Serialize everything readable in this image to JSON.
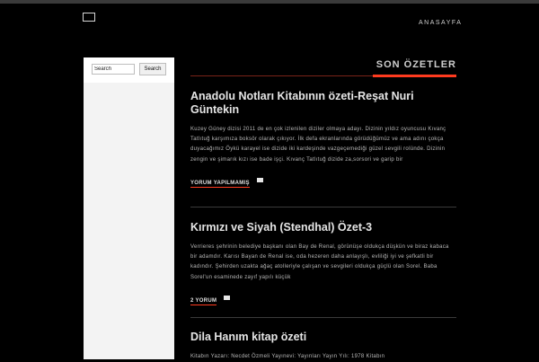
{
  "header": {
    "logo_icon": "square-outline-icon",
    "nav_home": "ANASAYFA"
  },
  "sidebar": {
    "search": {
      "placeholder": "Search",
      "button_label": "Search"
    }
  },
  "main": {
    "section_title": "SON ÖZETLER",
    "posts": [
      {
        "title": "Anadolu Notları Kitabının özeti-Reşat Nuri Güntekin",
        "excerpt": "Kuzey Güney dizisi 2011 de en çok izlenilen diziler olmaya adayı. Dizinin yıldız oyuncusu Kıvanç Tatlıtuğ karşımıza boksör olarak çıkıyor. İlk defa ekranlarında görüdüğümüz ve ama adını çokça duyacağımız Öykü karayel ise dizide iki kardeşinde vazgeçemediği güzel sevgili rolünde. Dizinin zengin ve şimarık kızı ise bade işçi. Kıvanç Tatlıtuğ dizide za,sorsori ve garip bir",
        "comments": "YORUM YAPILMAMIŞ"
      },
      {
        "title": "Kırmızı ve Siyah (Stendhal) Özet-3",
        "excerpt": "Verrieres şehrinin belediye başkanı olan Bay de Renal, görünüşe oldukça düşkün ve biraz kabaca bir adamdır. Karısı Bayan de Renal ise, oda hezeren daha anlayışlı, evliliği iyi ve şefkatli bir kadındır. Şehirden uzakta ağaç atolleriyle çalışan ve sevgileri oldukça güçlü olan Sorel. Baba Sorel'un esaminede zayıf yapılı küçük",
        "comments": "2 YORUM"
      },
      {
        "title": "Dila Hanım kitap özeti",
        "excerpt": "Kitabın Yazarı: Necdet Özmeli Yayınevi: Yayınları Yayın Yılı: 1978 Kitabın",
        "comments": ""
      }
    ]
  },
  "colors": {
    "background": "#000000",
    "accent": "#ff3b1f",
    "sidebar_bg": "#f3f3f3"
  }
}
